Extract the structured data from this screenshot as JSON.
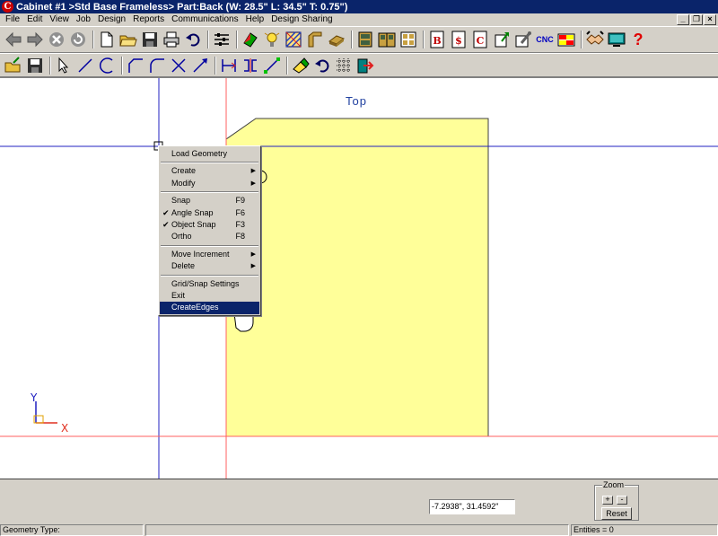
{
  "window": {
    "title": "Cabinet #1 >Std Base Frameless> Part:Back (W: 28.5\" L: 34.5\" T: 0.75\")",
    "app_icon_letter": "C",
    "controls": {
      "minimize": "_",
      "restore": "❐",
      "close": "×"
    }
  },
  "menubar": {
    "items": [
      "File",
      "Edit",
      "View",
      "Job",
      "Design",
      "Reports",
      "Communications",
      "Help",
      "Design Sharing"
    ]
  },
  "toolbar1": {
    "icons": [
      "back-arrow-icon",
      "forward-arrow-icon",
      "stop-icon",
      "refresh-icon",
      "new-document-icon",
      "open-folder-icon",
      "save-disk-icon",
      "print-icon",
      "undo-icon",
      "settings-sliders-icon",
      "materials-icon",
      "light-bulb-icon",
      "hatch-icon",
      "molding-icon",
      "panel-icon",
      "cabinet-icon",
      "cabinet-group-icon",
      "grid-view-icon",
      "b-report-icon",
      "dollar-report-icon",
      "c-report-icon",
      "export-icon",
      "tools-icon",
      "cnc-icon",
      "color-grid-icon",
      "handshake-icon",
      "screen-icon",
      "help-icon"
    ],
    "cnc_label": "CNC",
    "help_label": "?"
  },
  "toolbar2": {
    "icons": [
      "open-geometry-icon",
      "save-geometry-icon",
      "select-pointer-icon",
      "line-icon",
      "arc-icon",
      "corner-icon",
      "fillet-icon",
      "trim-icon",
      "extend-icon",
      "dimension-icon",
      "offset-icon",
      "node-edit-icon",
      "eraser-icon",
      "rotate-icon",
      "grid-icon",
      "exit-geometry-icon"
    ]
  },
  "canvas": {
    "view_label": "Top",
    "axis_labels": {
      "y": "Y",
      "x": "X"
    },
    "colors": {
      "part_fill": "#ffff99",
      "grid_blue": "#2020c0",
      "grid_red": "#ff6060",
      "axis_blue": "#2020c0",
      "axis_red": "#e03020"
    }
  },
  "context_menu": {
    "groups": [
      [
        {
          "label": "Load Geometry",
          "key": "",
          "submenu": false,
          "checked": false
        }
      ],
      [
        {
          "label": "Create",
          "key": "",
          "submenu": true,
          "checked": false
        },
        {
          "label": "Modify",
          "key": "",
          "submenu": true,
          "checked": false
        }
      ],
      [
        {
          "label": "Snap",
          "key": "F9",
          "submenu": false,
          "checked": false
        },
        {
          "label": "Angle Snap",
          "key": "F6",
          "submenu": false,
          "checked": true
        },
        {
          "label": "Object Snap",
          "key": "F3",
          "submenu": false,
          "checked": true
        },
        {
          "label": "Ortho",
          "key": "F8",
          "submenu": false,
          "checked": false
        }
      ],
      [
        {
          "label": "Move Increment",
          "key": "",
          "submenu": true,
          "checked": false
        },
        {
          "label": "Delete",
          "key": "",
          "submenu": true,
          "checked": false
        }
      ],
      [
        {
          "label": "Grid/Snap Settings",
          "key": "",
          "submenu": false,
          "checked": false
        },
        {
          "label": "Exit",
          "key": "",
          "submenu": false,
          "checked": false
        },
        {
          "label": "CreateEdges",
          "key": "",
          "submenu": false,
          "checked": false,
          "selected": true
        }
      ]
    ]
  },
  "bottom_panel": {
    "coordinates": "-7.2938\", 31.4592\"",
    "zoom": {
      "legend": "Zoom",
      "in_label": "+",
      "out_label": "-",
      "reset_label": "Reset"
    }
  },
  "statusbar": {
    "geometry_type": "Geometry Type:",
    "entities": "Entities =  0"
  }
}
